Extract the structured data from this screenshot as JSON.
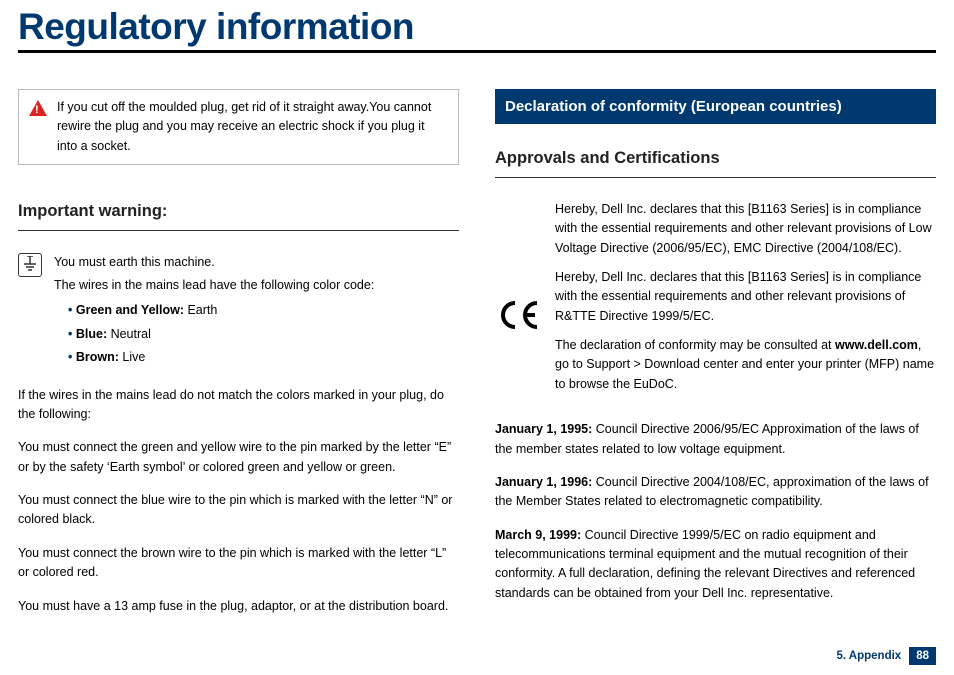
{
  "title": "Regulatory information",
  "left": {
    "warning_box": "If you cut off the moulded plug, get rid of it straight away.You cannot rewire the plug and you may receive an electric shock if you plug it into a socket.",
    "heading": "Important warning:",
    "earth_intro1": "You must earth this machine.",
    "earth_intro2": "The wires in the mains lead have the following color code:",
    "codes": {
      "gy_label": "Green and Yellow:",
      "gy_val": " Earth",
      "bl_label": "Blue:",
      "bl_val": " Neutral",
      "br_label": "Brown:",
      "br_val": " Live"
    },
    "p1": "If the wires in the mains lead do not match the colors marked in your plug, do the following:",
    "p2": "You must connect the green and yellow wire to the pin marked by the letter “E” or by the safety ‘Earth symbol’ or colored green and yellow or green.",
    "p3": "You must connect the blue wire to the pin which is marked with the letter “N” or colored black.",
    "p4": "You must connect the brown wire to the pin which is marked with the letter “L” or colored red.",
    "p5": "You must have a 13 amp fuse in the plug, adaptor, or at the distribution board."
  },
  "right": {
    "section_bar": "Declaration of conformity (European countries)",
    "heading": "Approvals and Certifications",
    "ce1": "Hereby, Dell Inc. declares that this [B1163 Series] is in compliance with the essential requirements and other relevant provisions of Low Voltage Directive (2006/95/EC), EMC Directive (2004/108/EC).",
    "ce2": "Hereby, Dell Inc. declares that this [B1163 Series] is in compliance with the essential requirements and other relevant provisions of R&TTE Directive 1999/5/EC.",
    "ce3a": "The declaration of conformity may be consulted at ",
    "ce3b": "www.dell.com",
    "ce3c": ", go to Support > Download center and enter your printer (MFP) name to browse the EuDoC.",
    "d1a": "January 1, 1995:",
    "d1b": " Council Directive 2006/95/EC Approximation of the laws of the member states related to low voltage equipment.",
    "d2a": "January 1, 1996:",
    "d2b": " Council Directive 2004/108/EC, approximation of the laws of the Member States related to electromagnetic compatibility.",
    "d3a": "March 9, 1999:",
    "d3b": " Council Directive 1999/5/EC on radio equipment and telecommunications terminal equipment and the mutual recognition of their conformity. A full declaration, defining the relevant Directives and referenced standards can be obtained from your Dell Inc. representative."
  },
  "footer": {
    "section": "5. Appendix",
    "page": "88"
  }
}
